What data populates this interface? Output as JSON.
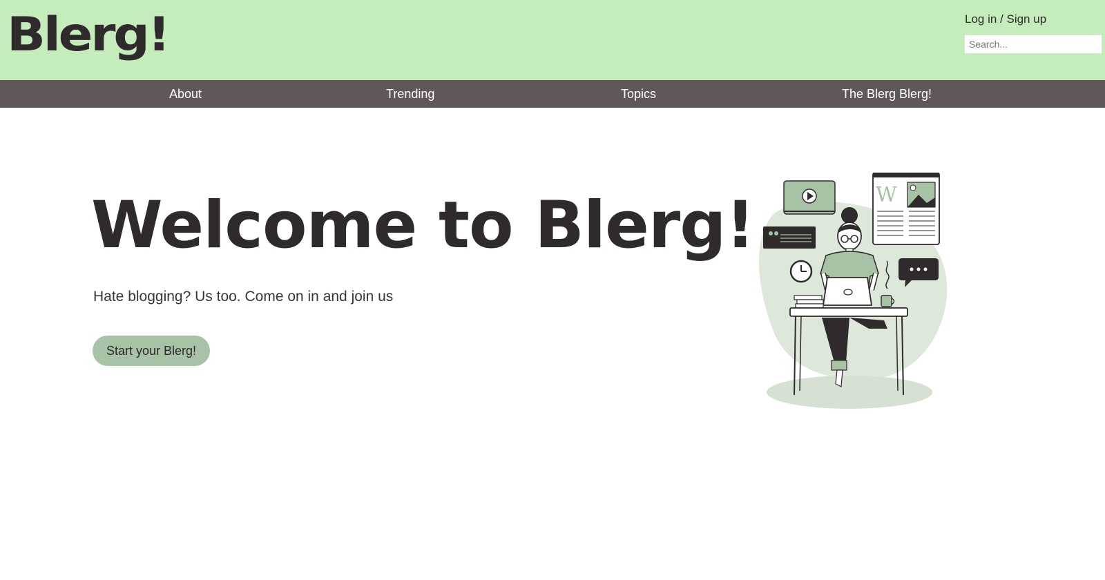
{
  "header": {
    "logo_text": "Blerg!",
    "login_label": "Log in / Sign up",
    "search_placeholder": "Search..."
  },
  "nav": {
    "items": [
      {
        "label": "About"
      },
      {
        "label": "Trending"
      },
      {
        "label": "Topics"
      },
      {
        "label": "The Blerg Blerg!"
      }
    ]
  },
  "hero": {
    "title": "Welcome to Blerg!",
    "subtitle": "Hate blogging? Us too. Come on in and join us",
    "cta_label": "Start your Blerg!"
  },
  "illustration": {
    "icon": "woman-blogging-at-desk-illustration",
    "page_glyph": "W"
  },
  "colors": {
    "header_bg": "#c5ecbb",
    "nav_bg": "#5f5758",
    "text_dark": "#2f2a2b",
    "accent_green": "#a7c2a4",
    "blob_green": "#dde7da"
  }
}
